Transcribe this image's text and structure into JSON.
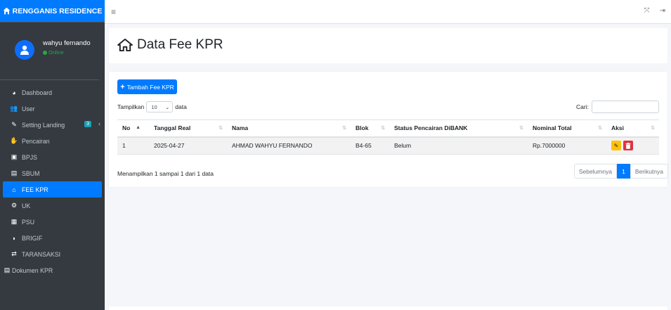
{
  "brand": {
    "name": "RENGGANIS RESIDENCE",
    "icon": "home-icon"
  },
  "user": {
    "name": "wahyu fernando",
    "status": "Online"
  },
  "sidebar": {
    "items": [
      {
        "label": "Dashboard",
        "icon": "tachometer-icon"
      },
      {
        "label": "User",
        "icon": "users-icon"
      },
      {
        "label": "Setting Landing",
        "icon": "edit-icon",
        "badge": "3"
      },
      {
        "label": "Pencairan",
        "icon": "hand-holding-icon"
      },
      {
        "label": "BPJS",
        "icon": "briefcase-medical-icon"
      },
      {
        "label": "SBUM",
        "icon": "file-icon"
      },
      {
        "label": "FEE KPR",
        "icon": "home-icon"
      },
      {
        "label": "UK",
        "icon": "cogs-icon"
      },
      {
        "label": "PSU",
        "icon": "building-icon"
      },
      {
        "label": "BRIGIF",
        "icon": "shield-icon"
      },
      {
        "label": "TARANSAKSI",
        "icon": "exchange-icon"
      },
      {
        "label": "Dokumen KPR",
        "icon": "file-alt-icon"
      }
    ]
  },
  "page": {
    "title": "Data Fee KPR"
  },
  "toolbar": {
    "add_label": "Tambah Fee KPR"
  },
  "table_controls": {
    "show_prefix": "Tampilkan",
    "show_value": "10",
    "show_suffix": "data",
    "search_label": "Cari:"
  },
  "table": {
    "headers": [
      "No",
      "Tanggal Real",
      "Nama",
      "Blok",
      "Status Pencairan DiBANK",
      "Nominal Total",
      "Aksi"
    ],
    "rows": [
      [
        "1",
        "2025-04-27",
        "AHMAD WAHYU FERNANDO",
        "B4-65",
        "Belum",
        "Rp.7000000"
      ]
    ]
  },
  "footer": {
    "info": "Menampilkan 1 sampai 1 dari 1 data",
    "prev": "Sebelumnya",
    "page": "1",
    "next": "Berikutnya"
  },
  "colors": {
    "primary": "#007bff",
    "sidebar": "#343a40",
    "warning": "#ffc107",
    "danger": "#dc3545"
  }
}
